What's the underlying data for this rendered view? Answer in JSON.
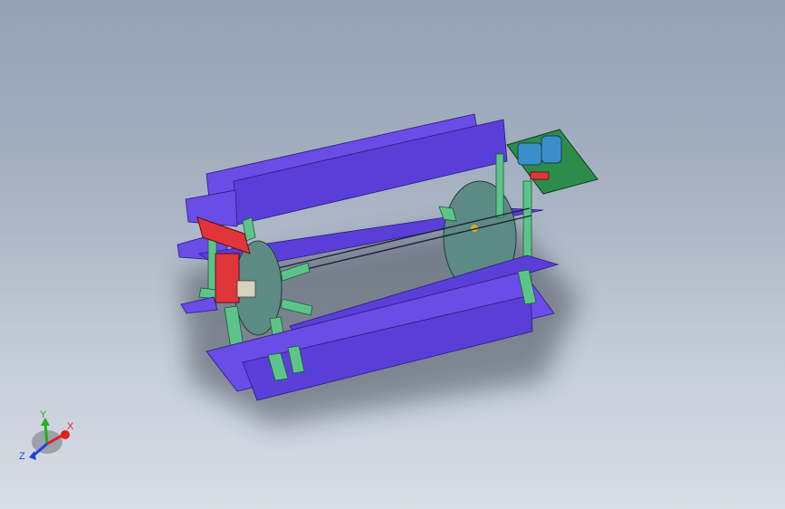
{
  "viewport": {
    "background_top": "#93a1b4",
    "background_bottom": "#d9dee5"
  },
  "model": {
    "paddle_color": "#6a4ce6",
    "paddle_edge": "#2a1a80",
    "frame_color": "#5cc48a",
    "frame_edge": "#1e5a38",
    "disc_color": "#5e8a86",
    "bracket_color": "#e0353a",
    "base_plate_color": "#2c8c4a",
    "motor_color": "#3a8fc8"
  },
  "triad": {
    "x_label": "X",
    "y_label": "Y",
    "z_label": "Z",
    "x_color": "#e02020",
    "y_color": "#20b020",
    "z_color": "#2040e0",
    "x_icon": "arrow-x-icon",
    "y_icon": "arrow-y-icon",
    "z_icon": "arrow-z-icon"
  }
}
